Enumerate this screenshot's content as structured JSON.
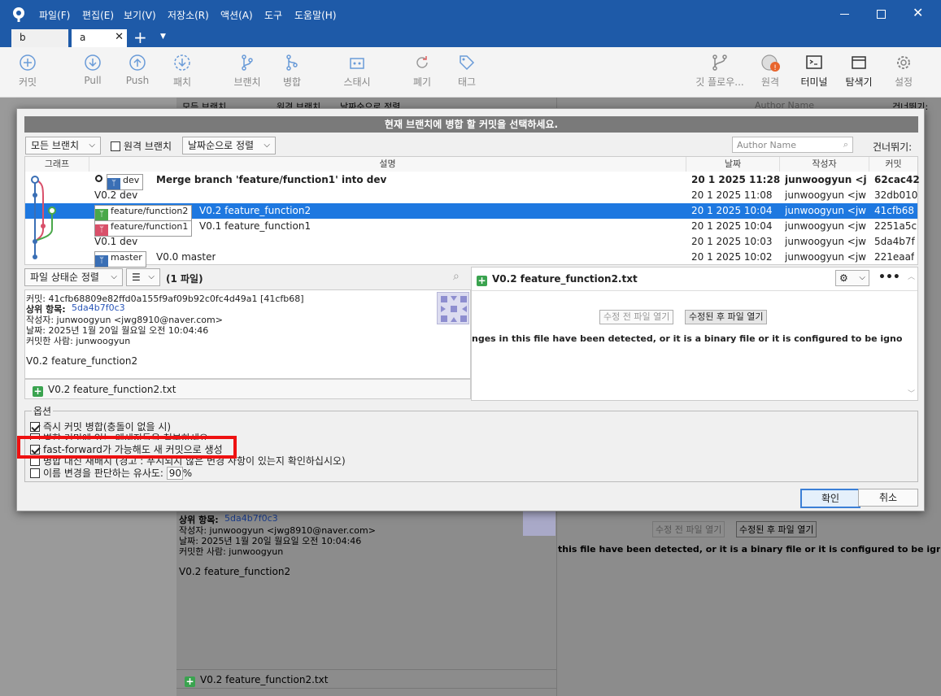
{
  "menu": [
    "파일(F)",
    "편집(E)",
    "보기(V)",
    "저장소(R)",
    "액션(A)",
    "도구",
    "도움말(H)"
  ],
  "tabs": [
    "b",
    "a"
  ],
  "toolbar": [
    {
      "label": "커밋",
      "icon": "plus-circle-icon"
    },
    {
      "label": "Pull",
      "icon": "pull-icon"
    },
    {
      "label": "Push",
      "icon": "push-icon"
    },
    {
      "label": "패치",
      "icon": "patch-icon"
    },
    {
      "label": "브랜치",
      "icon": "branch-icon"
    },
    {
      "label": "병합",
      "icon": "merge-icon"
    },
    {
      "label": "스태시",
      "icon": "stash-icon"
    },
    {
      "label": "폐기",
      "icon": "discard-icon"
    },
    {
      "label": "태그",
      "icon": "tag-icon"
    }
  ],
  "toolbar_right": [
    {
      "label": "깃 플로우...",
      "icon": "gitflow-icon"
    },
    {
      "label": "원격",
      "icon": "remote-icon"
    },
    {
      "label": "터미널",
      "icon": "terminal-icon"
    },
    {
      "label": "탐색기",
      "icon": "explorer-icon"
    },
    {
      "label": "설정",
      "icon": "settings-icon"
    }
  ],
  "background": {
    "filter_all": "모든 브랜치",
    "filter_remote": "원격 브랜치",
    "sort": "날짜순으로 정렬",
    "author_placeholder": "Author Name",
    "jump": "건너뛰기:",
    "parent": "상위 항목:",
    "parent_hash": "5da4b7f0c3",
    "author": "작성자: junwoogyun <jwg8910@naver.com>",
    "date": "날짜: 2025년 1월 20일 월요일 오전 10:04:46",
    "committer": "커밋한 사람: junwoogyun",
    "message": "V0.2 feature_function2",
    "file": "V0.2 feature_function2.txt",
    "btn_before": "수정 전 파일 열기",
    "btn_after": "수정된 후 파일 열기",
    "binary_msg": "this file have been detected, or it is a binary file or it is configured to be ignored by"
  },
  "dialog": {
    "title": "현재 브랜치에 병합 할 커밋을 선택하세요.",
    "filter_all": "모든 브랜치",
    "filter_remote": "원격 브랜치",
    "sort": "날짜순으로 정렬",
    "author_placeholder": "Author Name",
    "jump": "건너뛰기:",
    "columns": [
      "그래프",
      "설명",
      "날짜",
      "작성자",
      "커밋"
    ],
    "rows": [
      {
        "badge": "dev",
        "badge_color": "#3a6fb5",
        "desc": "Merge branch 'feature/function1' into dev",
        "date": "20 1 2025 11:28",
        "author": "junwoogyun <jwg",
        "commit": "62cac42",
        "bold": true
      },
      {
        "badge": "",
        "desc": "V0.2 dev",
        "date": "20 1 2025 11:08",
        "author": "junwoogyun <jwg",
        "commit": "32db010"
      },
      {
        "badge": "feature/function2",
        "badge_color": "#4aa84a",
        "desc": "V0.2 feature_function2",
        "date": "20 1 2025 10:04",
        "author": "junwoogyun <jwg",
        "commit": "41cfb68",
        "selected": true
      },
      {
        "badge": "feature/function1",
        "badge_color": "#d9506a",
        "desc": "V0.1 feature_function1",
        "date": "20 1 2025 10:04",
        "author": "junwoogyun <jwg",
        "commit": "2251a5c"
      },
      {
        "badge": "",
        "desc": "V0.1 dev",
        "date": "20 1 2025 10:03",
        "author": "junwoogyun <jwg",
        "commit": "5da4b7f"
      },
      {
        "badge": "master",
        "badge_color": "#3a6fb5",
        "desc": "V0.0 master",
        "date": "20 1 2025 10:02",
        "author": "junwoogyun <jwg",
        "commit": "221eaaf"
      }
    ],
    "file_sort": "파일 상태순 정렬",
    "file_count": "(1 파일)",
    "commit_line": "커밋: 41cfb68809e82ffd0a155f9af09b92c0fc4d49a1 [41cfb68]",
    "parent_label": "상위 항목:",
    "parent_hash": "5da4b7f0c3",
    "author_line": "작성자: junwoogyun <jwg8910@naver.com>",
    "date_line": "날짜: 2025년 1월 20일 월요일 오전 10:04:46",
    "committer_line": "커밋한 사람: junwoogyun",
    "message": "V0.2 feature_function2",
    "file": "V0.2 feature_function2.txt",
    "diff_file": "V0.2 feature_function2.txt",
    "btn_before": "수정 전 파일 열기",
    "btn_after": "수정된 후 파일 열기",
    "binary_msg": "nges in this file have been detected, or it is a binary file or it is configured to be ignored by the file",
    "options_title": "옵션",
    "options": [
      {
        "label": "즉시 커밋 병합(충돌이 없을 시)",
        "checked": true
      },
      {
        "label": "병합 커밋에 있는 메세지들을 첨부하세요",
        "checked": false
      },
      {
        "label": "fast-forward가 가능해도 새 커밋으로 생성",
        "checked": true
      },
      {
        "label": "병합 대신 재배치 (경고 : 푸시되지 않은 변경 사항이 있는지 확인하십시오)",
        "checked": false
      },
      {
        "label": "이름 변경을 판단하는 유사도:",
        "checked": false
      }
    ],
    "similarity": "90",
    "percent": "%",
    "ok": "확인",
    "cancel": "취소"
  }
}
